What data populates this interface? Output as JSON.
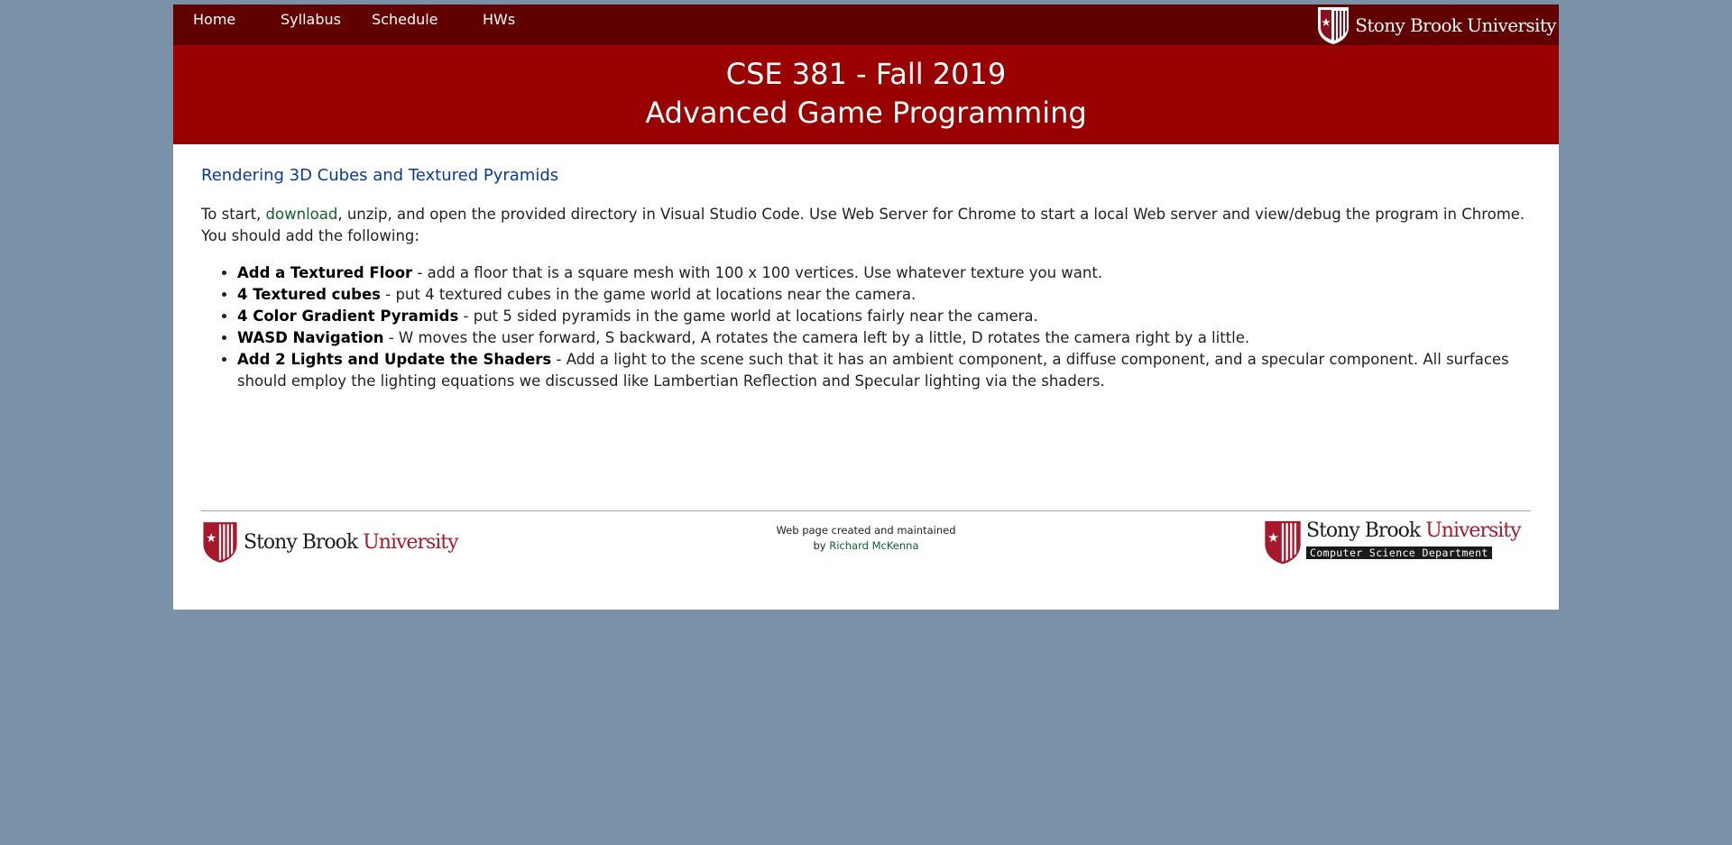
{
  "nav": {
    "items": [
      {
        "label": "Home"
      },
      {
        "label": "Syllabus"
      },
      {
        "label": "Schedule"
      },
      {
        "label": "HWs"
      }
    ],
    "logo_text": "Stony Brook University"
  },
  "banner": {
    "line1": "CSE 381 - Fall 2019",
    "line2": "Advanced Game Programming"
  },
  "content": {
    "title": "Rendering 3D Cubes and Textured Pyramids",
    "intro": {
      "before": "To start, ",
      "link": "download",
      "after": ", unzip, and open the provided directory in Visual Studio Code. Use Web Server for Chrome to start a local Web server and view/debug the program in Chrome. You should add the following:"
    },
    "tasks": [
      {
        "name": "Add a Textured Floor",
        "desc": " - add a floor that is a square mesh with 100 x 100 vertices. Use whatever texture you want."
      },
      {
        "name": "4 Textured cubes",
        "desc": " - put 4 textured cubes in the game world at locations near the camera."
      },
      {
        "name": "4 Color Gradient Pyramids",
        "desc": " - put 5 sided pyramids in the game world at locations fairly near the camera."
      },
      {
        "name": "WASD Navigation",
        "desc": " - W moves the user forward, S backward, A rotates the camera left by a little, D rotates the camera right by a little."
      },
      {
        "name": "Add 2 Lights and Update the Shaders",
        "desc": " - Add a light to the scene such that it has an ambient component, a diffuse component, and a specular component. All surfaces should employ the lighting equations we discussed like Lambertian Reflection and Specular lighting via the shaders."
      }
    ]
  },
  "footer": {
    "left_logo": {
      "stony": "Stony Brook ",
      "university": "University"
    },
    "credit_line1": "Web page created and maintained",
    "credit_by": "by ",
    "credit_author": "Richard McKenna",
    "right_logo": {
      "stony": "Stony Brook ",
      "university": "University",
      "dept": "Computer Science Department"
    }
  },
  "colors": {
    "background": "#7a91a8",
    "nav_bg": "#600000",
    "banner_bg": "#990000",
    "title_blue": "#0b3a91",
    "link_green": "#0f5e2b",
    "logo_red": "#a8172a"
  }
}
